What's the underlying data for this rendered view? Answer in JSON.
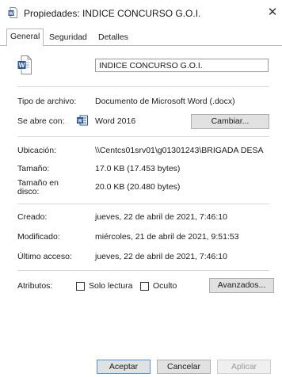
{
  "window": {
    "title": "Propiedades: INDICE CONCURSO G.O.I.",
    "close_glyph": "✕"
  },
  "tabs": [
    {
      "label": "General",
      "active": true
    },
    {
      "label": "Seguridad",
      "active": false
    },
    {
      "label": "Detalles",
      "active": false
    }
  ],
  "file": {
    "name": "INDICE CONCURSO G.O.I.",
    "icon": "word-document-icon"
  },
  "details": {
    "tipo_label": "Tipo de archivo:",
    "tipo_value": "Documento de Microsoft Word (.docx)",
    "abre_label": "Se abre con:",
    "abre_value": "Word 2016",
    "cambiar_label": "Cambiar...",
    "ubicacion_label": "Ubicación:",
    "ubicacion_value": "\\\\Centcs01srv01\\g01301243\\BRIGADA DESA",
    "tamano_label": "Tamaño:",
    "tamano_value": "17.0 KB (17.453 bytes)",
    "disco_label_1": "Tamaño en",
    "disco_label_2": "disco:",
    "disco_value": "20.0 KB (20.480 bytes)",
    "creado_label": "Creado:",
    "creado_value": "jueves, 22 de abril de 2021, 7:46:10",
    "modificado_label": "Modificado:",
    "modificado_value": "miércoles, 21 de abril de 2021, 9:51:53",
    "acceso_label": "Último acceso:",
    "acceso_value": "jueves, 22 de abril de 2021, 7:46:10",
    "atributos_label": "Atributos:",
    "solo_lectura_label": "Solo lectura",
    "oculto_label": "Oculto",
    "avanzados_label": "Avanzados..."
  },
  "buttons": {
    "aceptar": "Aceptar",
    "cancelar": "Cancelar",
    "aplicar": "Aplicar"
  },
  "colors": {
    "word_blue": "#2b579a",
    "accent_border": "#4a8fd8",
    "disabled_text": "#9b9b9b"
  }
}
